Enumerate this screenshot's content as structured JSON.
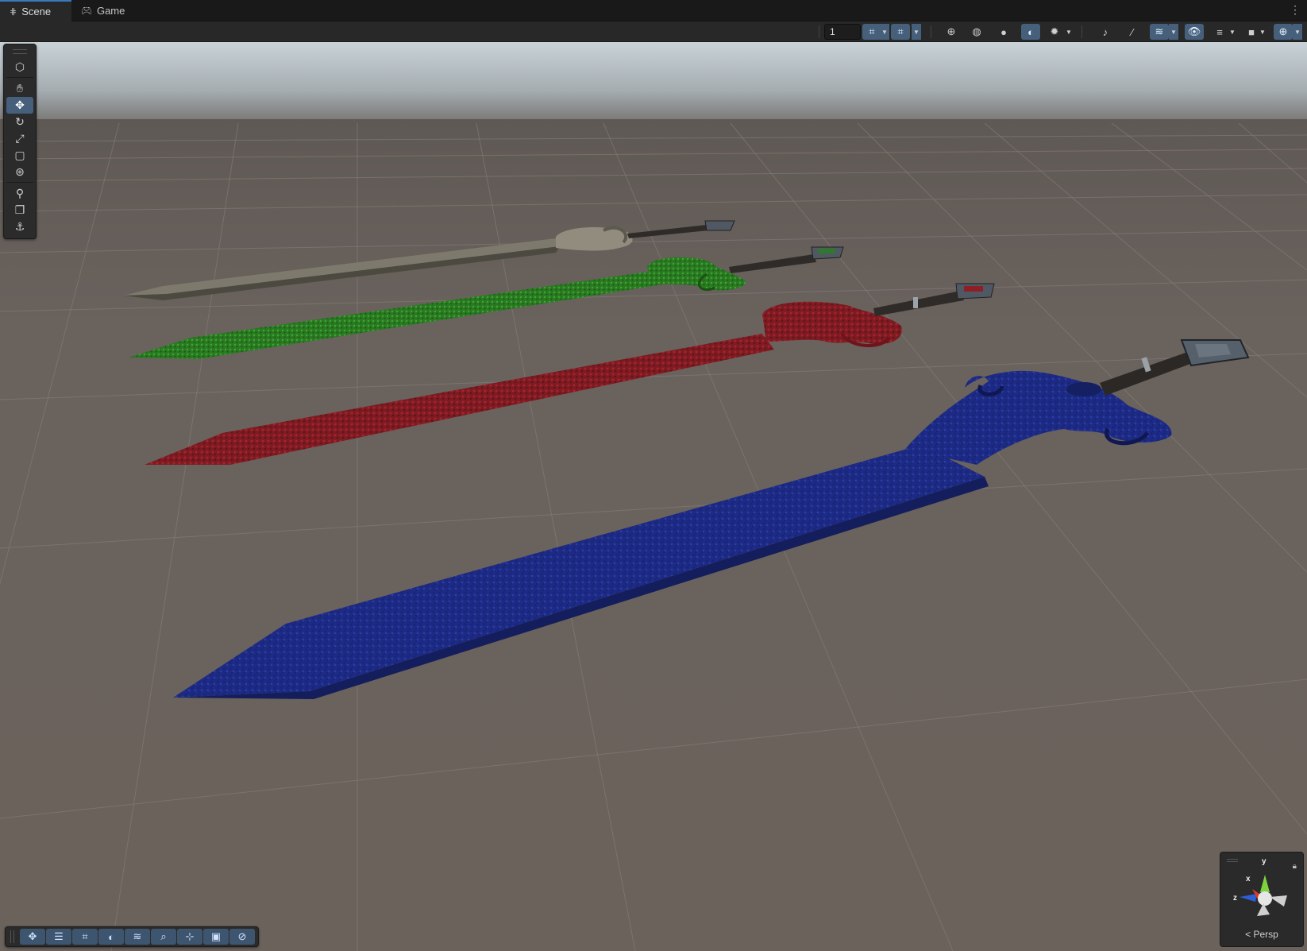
{
  "tabs": [
    {
      "label": "Scene",
      "icon": "grid-icon",
      "active": true
    },
    {
      "label": "Game",
      "icon": "gamepad-icon",
      "active": false
    }
  ],
  "toolbar": {
    "grid_size_value": "1",
    "accent_color": "#46607c",
    "buttons": [
      "grid-snap-icon",
      "increment-snap-icon",
      "draw-mode-icon",
      "shading-wire-icon",
      "shading-solid-icon",
      "lighting-icon",
      "effects-icon",
      "audio-icon",
      "fx-icon",
      "layers-icon",
      "visibility-icon",
      "scene-layers-icon",
      "camera-icon",
      "gizmos-icon"
    ]
  },
  "left_tools": [
    "view-tool-icon",
    "hand-tool-icon",
    "move-tool-icon",
    "rotate-tool-icon",
    "scale-tool-icon",
    "rect-tool-icon",
    "transform-tool-icon",
    "custom-tool-icon",
    "component-tool-icon",
    "probe-tool-icon"
  ],
  "bottom_tools": [
    "move-icon",
    "align-icon",
    "grid-icon",
    "sphere-icon",
    "layers-icon",
    "search-icon",
    "pivot-icon",
    "display-icon",
    "compass-icon"
  ],
  "gizmo": {
    "projection_label": "Persp",
    "axes": [
      "y",
      "x",
      "z"
    ]
  },
  "scene": {
    "objects": [
      {
        "name": "sword-silver",
        "color": "#8b8676"
      },
      {
        "name": "sword-green",
        "color": "#2f8a2a"
      },
      {
        "name": "sword-red",
        "color": "#8f1b22"
      },
      {
        "name": "sword-blue",
        "color": "#1c2c86"
      }
    ]
  }
}
